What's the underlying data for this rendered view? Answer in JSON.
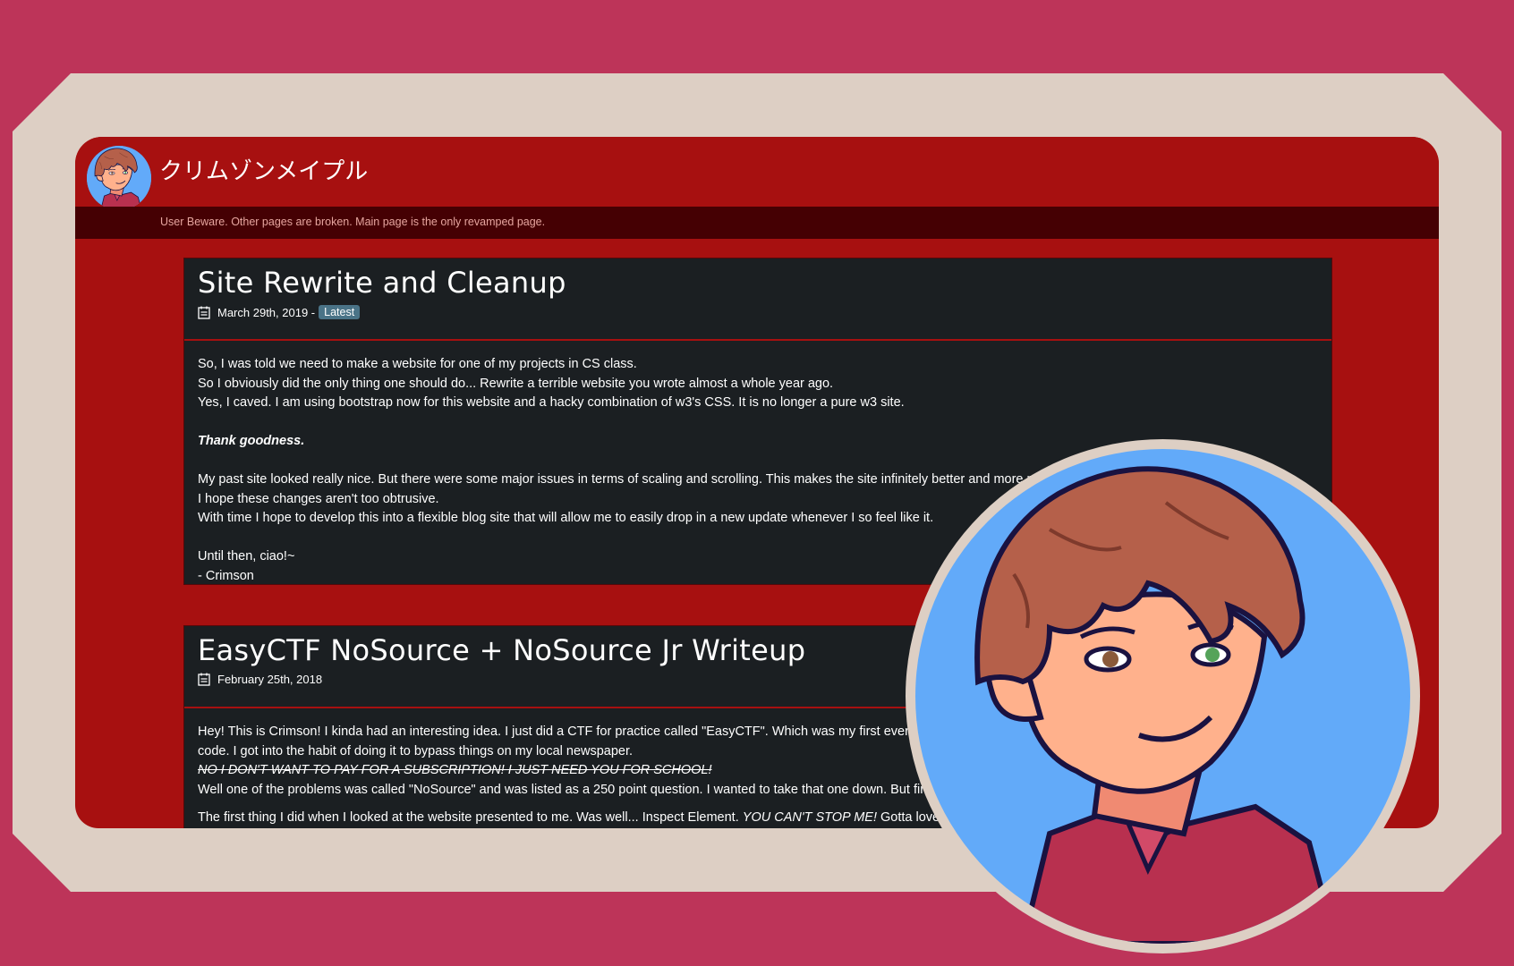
{
  "site": {
    "brand": "クリムゾンメイプル",
    "notice": "User Beware. Other pages are broken. Main page is the only revamped page."
  },
  "posts": [
    {
      "title": "Site Rewrite and Cleanup",
      "date": "March 29th, 2019 -",
      "badge": "Latest",
      "paragraphs": [
        "So, I was told we need to make a website for one of my projects in CS class.",
        "So I obviously did the only thing one should do... Rewrite a terrible website you wrote almost a whole year ago.",
        "Yes, I caved. I am using bootstrap now for this website and a hacky combination of w3's CSS. It is no longer a pure w3 site.",
        "Thank goodness.",
        "My past site looked really nice. But there were some major issues in terms of scaling and scrolling. This makes the site infinitely better and more r",
        "I hope these changes aren't too obtrusive.",
        "With time I hope to develop this into a flexible blog site that will allow me to easily drop in a new update whenever I so feel like it.",
        "Until then, ciao!~",
        "- Crimson"
      ]
    },
    {
      "title": "EasyCTF NoSource + NoSource Jr Writeup",
      "date": "February 25th, 2018",
      "paragraphs": [
        "Hey! This is Crimson! I kinda had an interesting idea. I just did a CTF for practice called \"EasyCTF\". Which was my first ever. On",
        "code. I got into the habit of doing it to bypass things on my local newspaper.",
        "NO I DON'T WANT TO PAY FOR A SUBSCRIPTION! I JUST NEED YOU FOR SCHOOL!",
        "Well one of the problems was called \"NoSource\" and was listed as a 250 point question. I wanted to take that one down. But firs",
        "The first thing I did when I looked at the website presented to me. Was well... Inspect Element.",
        "YOU CAN'T STOP ME!",
        "Gotta love wh"
      ]
    }
  ],
  "colors": {
    "outer_bg": "#bd3459",
    "frame": "#ddcfc4",
    "page_red": "#a71010",
    "notice_bar": "#450003",
    "card_bg": "#1b1f22",
    "badge": "#4a7387",
    "avatar_sky": "#62aaf9",
    "hair": "#b5604a",
    "skin": "#ffb18c"
  }
}
